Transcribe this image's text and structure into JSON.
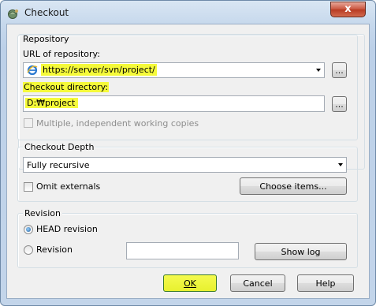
{
  "window": {
    "title": "Checkout",
    "close_glyph": "x"
  },
  "repository": {
    "group_label": "Repository",
    "url_label": "URL of repository:",
    "url_value": "https://server/svn/project/",
    "browse_label": "...",
    "dir_label": "Checkout directory:",
    "dir_value": "D:₩project",
    "dir_browse_label": "...",
    "multiple_wc_label": "Multiple, independent working copies"
  },
  "depth": {
    "group_label": "Checkout Depth",
    "selected": "Fully recursive",
    "omit_externals_label": "Omit externals",
    "choose_items_label": "Choose items..."
  },
  "revision": {
    "group_label": "Revision",
    "head_label": "HEAD revision",
    "revision_label": "Revision",
    "revision_value": "",
    "show_log_label": "Show log"
  },
  "buttons": {
    "ok": "OK",
    "cancel": "Cancel",
    "help": "Help"
  },
  "colors": {
    "highlight": "#f5fa3a",
    "highlight_border": "#3a7a2a"
  }
}
